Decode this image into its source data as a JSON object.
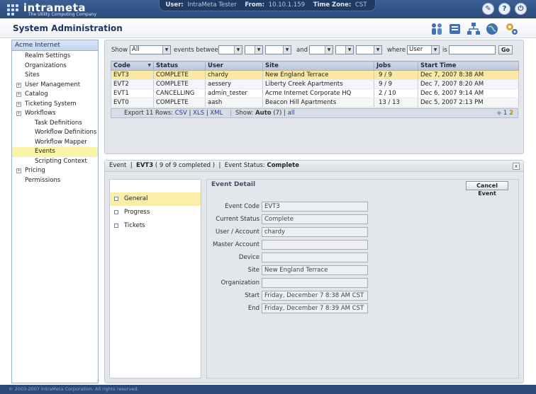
{
  "app": {
    "brand": "intrameta",
    "tagline": "The Utility Computing Company",
    "user_label": "User:",
    "user_value": "IntraMeta Tester",
    "from_label": "From:",
    "from_value": "10.10.1.159",
    "tz_label": "Time Zone:",
    "tz_value": "CST"
  },
  "header": {
    "title": "System Administration"
  },
  "nav": {
    "root": "Acme Internet",
    "items": [
      {
        "label": "Realm Settings",
        "indent": 1,
        "expandable": false
      },
      {
        "label": "Organizations",
        "indent": 1,
        "expandable": false
      },
      {
        "label": "Sites",
        "indent": 1,
        "expandable": false
      },
      {
        "label": "User Management",
        "indent": 1,
        "expandable": true
      },
      {
        "label": "Catalog",
        "indent": 1,
        "expandable": true
      },
      {
        "label": "Ticketing System",
        "indent": 1,
        "expandable": true
      },
      {
        "label": "Workflows",
        "indent": 1,
        "expandable": true
      },
      {
        "label": "Task Definitions",
        "indent": 2,
        "expandable": false
      },
      {
        "label": "Workflow Definitions",
        "indent": 2,
        "expandable": false
      },
      {
        "label": "Workflow Mapper",
        "indent": 2,
        "expandable": false
      },
      {
        "label": "Events",
        "indent": 2,
        "expandable": false,
        "selected": true
      },
      {
        "label": "Scripting Context",
        "indent": 2,
        "expandable": false
      },
      {
        "label": "Pricing",
        "indent": 1,
        "expandable": true
      },
      {
        "label": "Permissions",
        "indent": 1,
        "expandable": false
      }
    ]
  },
  "filter": {
    "show_label": "Show",
    "show_value": "All",
    "between_label": "events between",
    "and_label": "and",
    "where_label": "where",
    "where_value": "User",
    "is_label": "is",
    "go_label": "Go"
  },
  "grid": {
    "columns": [
      "Code",
      "Status",
      "User",
      "Site",
      "Jobs",
      "Start Time"
    ],
    "rows": [
      {
        "code": "EVT3",
        "status": "COMPLETE",
        "user": "chardy",
        "site": "New England Terrace",
        "jobs": "9 / 9",
        "start": "Dec 7, 2007 8:38 AM",
        "selected": true
      },
      {
        "code": "EVT2",
        "status": "COMPLETE",
        "user": "aessery",
        "site": "Liberty Creek Apartments",
        "jobs": "9 / 9",
        "start": "Dec 7, 2007 8:20 AM"
      },
      {
        "code": "EVT1",
        "status": "CANCELLING",
        "user": "admin_tester",
        "site": "Acme Internet Corporate HQ",
        "jobs": "2 / 10",
        "start": "Dec 6, 2007 9:14 AM"
      },
      {
        "code": "EVT0",
        "status": "COMPLETE",
        "user": "aash",
        "site": "Beacon Hill Apartments",
        "jobs": "13 / 13",
        "start": "Dec 5, 2007 2:13 PM"
      }
    ],
    "export_label": "Export 11 Rows:",
    "export_csv": "CSV",
    "export_xls": "XLS",
    "export_xml": "XML",
    "show_label": "Show:",
    "show_auto": "Auto",
    "show_count": "(7)",
    "show_all": "all",
    "pages": [
      "1",
      "2"
    ],
    "current_page": "2"
  },
  "detail": {
    "head_event": "Event",
    "head_code": "EVT3",
    "head_progress": "( 9 of 9 completed )",
    "head_status_label": "Event Status:",
    "head_status_value": "Complete",
    "close_label": "x",
    "tabs": [
      "General",
      "Progress",
      "Tickets"
    ],
    "title": "Event Detail",
    "cancel_label": "Cancel Event",
    "fields": [
      {
        "label": "Event Code",
        "value": "EVT3"
      },
      {
        "label": "Current Status",
        "value": "Complete"
      },
      {
        "label": "User / Account",
        "value": "chardy"
      },
      {
        "label": "Master Account",
        "value": ""
      },
      {
        "label": "Device",
        "value": ""
      },
      {
        "label": "Site",
        "value": "New England Terrace"
      },
      {
        "label": "Organization",
        "value": ""
      },
      {
        "label": "Start",
        "value": "Friday, December 7 8:38 AM CST"
      },
      {
        "label": "End",
        "value": "Friday, December 7 8:39 AM CST"
      }
    ]
  },
  "footer": {
    "copyright": "© 2003-2007 IntraMeta Corporation.  All rights reserved."
  },
  "colors": {
    "selected_row": "#fbe9a3",
    "header_blue": "#2b4a7a",
    "nav_selected": "#fbf3a6"
  }
}
